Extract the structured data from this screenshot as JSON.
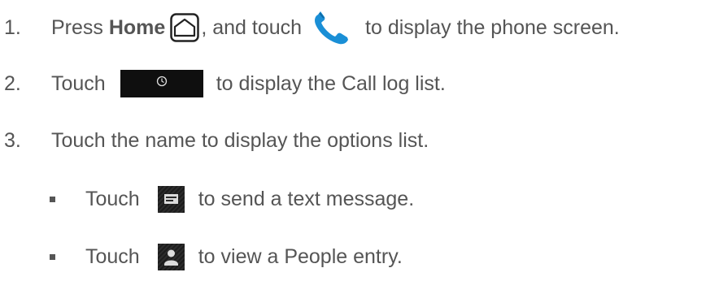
{
  "steps": [
    {
      "number": "1.",
      "parts": {
        "a": "Press ",
        "b": "Home",
        "c": ", and touch",
        "d": "to display the phone screen."
      },
      "icons": [
        "home-icon",
        "phone-icon"
      ]
    },
    {
      "number": "2.",
      "parts": {
        "a": "Touch",
        "b": "to display the Call log list."
      },
      "icons": [
        "clock-icon"
      ]
    },
    {
      "number": "3.",
      "parts": {
        "a": "Touch the name to display the options list."
      }
    }
  ],
  "substeps": [
    {
      "parts": {
        "a": "Touch",
        "b": "to send a text message."
      },
      "icons": [
        "message-icon"
      ]
    },
    {
      "parts": {
        "a": "Touch",
        "b": "to view a People entry."
      },
      "icons": [
        "person-icon"
      ]
    }
  ],
  "colors": {
    "text": "#555555",
    "phone_icon": "#1a8fd6",
    "icon_bg": "#0f0f0f"
  }
}
